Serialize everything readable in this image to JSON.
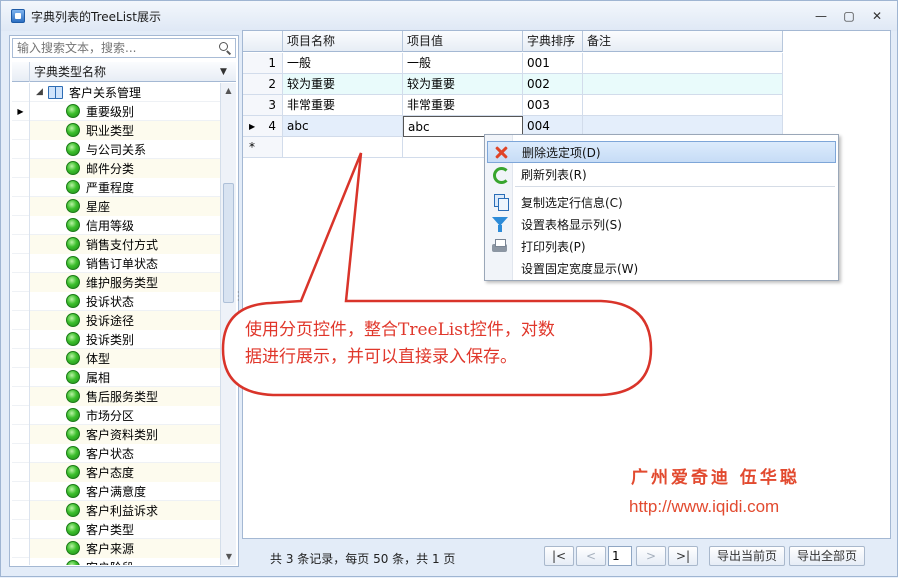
{
  "window": {
    "title": "字典列表的TreeList展示",
    "controls": [
      "—",
      "▢",
      "✕"
    ]
  },
  "search": {
    "placeholder": "输入搜索文本，搜索..."
  },
  "tree": {
    "column": "字典类型名称",
    "root": "客户关系管理",
    "items": [
      "重要级别",
      "职业类型",
      "与公司关系",
      "邮件分类",
      "严重程度",
      "星座",
      "信用等级",
      "销售支付方式",
      "销售订单状态",
      "维护服务类型",
      "投诉状态",
      "投诉途径",
      "投诉类别",
      "体型",
      "属相",
      "售后服务类型",
      "市场分区",
      "客户资料类别",
      "客户状态",
      "客户态度",
      "客户满意度",
      "客户利益诉求",
      "客户类型",
      "客户来源",
      "客户阶段"
    ]
  },
  "grid": {
    "columns": [
      "项目名称",
      "项目值",
      "字典排序",
      "备注"
    ],
    "rows": [
      {
        "num": "1",
        "name": "一般",
        "value": "一般",
        "sort": "001",
        "note": ""
      },
      {
        "num": "2",
        "name": "较为重要",
        "value": "较为重要",
        "sort": "002",
        "note": ""
      },
      {
        "num": "3",
        "name": "非常重要",
        "value": "非常重要",
        "sort": "003",
        "note": ""
      },
      {
        "num": "4",
        "name": "abc",
        "value": "abc",
        "sort": "004",
        "note": ""
      }
    ],
    "new_row_marker": "*"
  },
  "context_menu": {
    "items": [
      {
        "label": "删除选定项(D)",
        "icon": "delete-icon"
      },
      {
        "label": "刷新列表(R)",
        "icon": "refresh-icon"
      },
      {
        "label": "复制选定行信息(C)",
        "icon": "copy-icon"
      },
      {
        "label": "设置表格显示列(S)",
        "icon": "filter-icon"
      },
      {
        "label": "打印列表(P)",
        "icon": "print-icon"
      },
      {
        "label": "设置固定宽度显示(W)",
        "icon": ""
      }
    ]
  },
  "callout": {
    "line1": "使用分页控件，整合TreeList控件，对数",
    "line2": "据进行展示，并可以直接录入保存。"
  },
  "branding": {
    "name": "广州爱奇迪 伍华聪",
    "url": "http://www.iqidi.com"
  },
  "pager": {
    "info": "共 3 条记录，每页 50 条，共 1 页",
    "first": "|<",
    "prev": "<",
    "page": "1",
    "next": ">",
    "last": ">|",
    "export_current": "导出当前页",
    "export_all": "导出全部页"
  },
  "colors": {
    "accent": "#e0372b",
    "selection": "#c6dcf6"
  }
}
